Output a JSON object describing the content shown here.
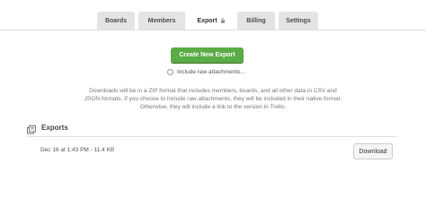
{
  "tabs": [
    {
      "label": "Boards",
      "active": false
    },
    {
      "label": "Members",
      "active": false
    },
    {
      "label": "Export",
      "active": true,
      "icon": "lock-icon"
    },
    {
      "label": "Billing",
      "active": false
    },
    {
      "label": "Settings",
      "active": false
    }
  ],
  "export": {
    "create_button_label": "Create New Export",
    "raw_attachments_label": "Include raw attachments…",
    "raw_attachments_checked": false,
    "description": "Downloads will be in a ZIP format that includes members, boards, and all other data in CSV and JSON formats. If you choose to include raw attachments, they will be included in their native format. Otherwise, they will include a link to the version in Trello."
  },
  "exports_list": {
    "title": "Exports",
    "icon": "exports-icon",
    "items": [
      {
        "info": "Dec 16 at 1:43 PM - 11.4 KB",
        "download_label": "Download"
      }
    ]
  },
  "colors": {
    "primary_button": "#5aac44",
    "tab_inactive": "#e2e4e6",
    "tab_active": "#ffffff"
  }
}
